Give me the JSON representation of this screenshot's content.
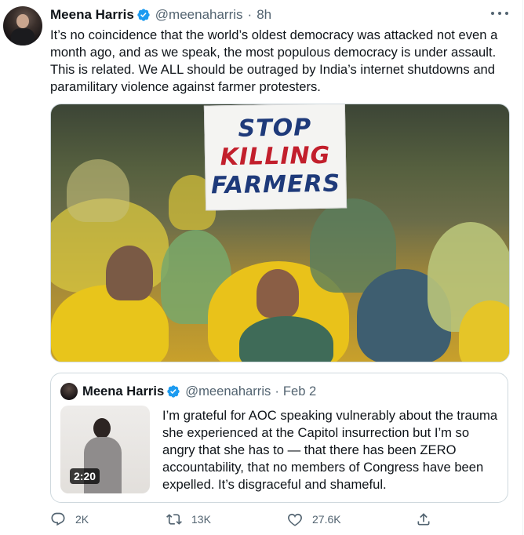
{
  "tweet": {
    "author_name": "Meena Harris",
    "handle": "@meenaharris",
    "separator": "·",
    "time": "8h",
    "text": "It’s no coincidence that the world’s oldest democracy was attacked not even a month ago, and as we speak, the most populous democracy is under assault. This is related. We ALL should be outraged by India’s internet shutdowns and paramilitary violence against farmer protesters.",
    "image_sign": {
      "line1": "STOP",
      "line2": "KILLING",
      "line3": "FARMERS"
    }
  },
  "quoted_tweet": {
    "author_name": "Meena Harris",
    "handle": "@meenaharris",
    "separator": "·",
    "date": "Feb 2",
    "video_duration": "2:20",
    "text": "I’m grateful for AOC speaking vulnerably about the trauma she experienced at the Capitol insurrection but I’m so angry that she has to — that there has been ZERO accountability, that no members of Congress have been expelled. It’s disgraceful and shameful."
  },
  "actions": {
    "replies": "2K",
    "retweets": "13K",
    "likes": "27.6K"
  },
  "colors": {
    "text": "#0f1419",
    "secondary": "#536471",
    "verified": "#1d9bf0",
    "border": "#cfd9de"
  },
  "icons": [
    "verified-badge-icon",
    "more-icon",
    "reply-icon",
    "retweet-icon",
    "like-icon",
    "share-icon"
  ]
}
